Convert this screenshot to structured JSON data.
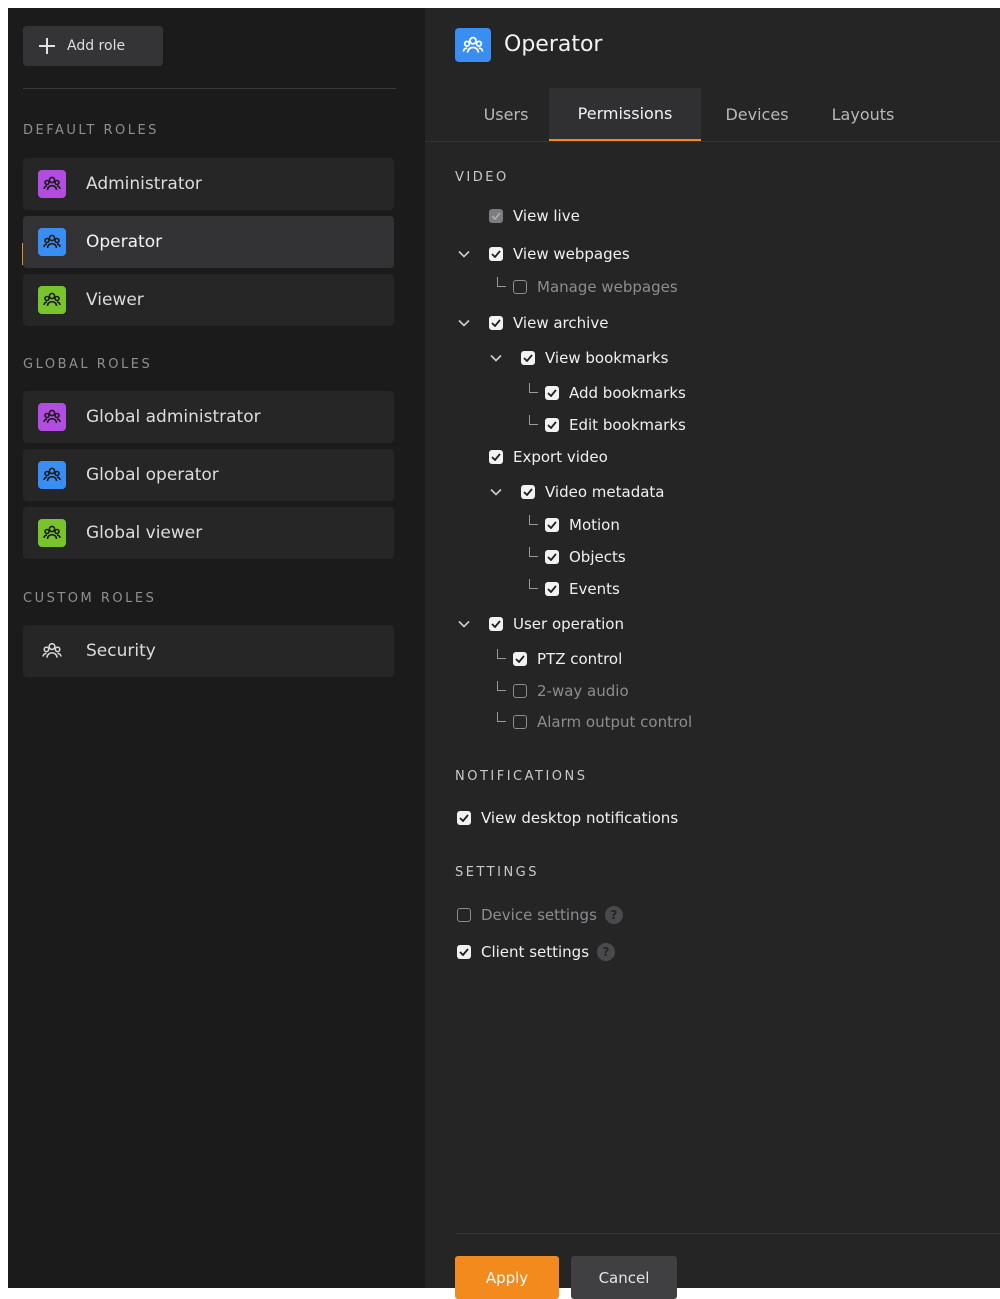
{
  "sidebar": {
    "add_role_label": "Add role",
    "sections": [
      {
        "title": "DEFAULT ROLES",
        "items": [
          {
            "label": "Administrator",
            "color": "#b34ce0"
          },
          {
            "label": "Operator",
            "color": "#3a8ef2",
            "selected": true
          },
          {
            "label": "Viewer",
            "color": "#78c42a"
          }
        ]
      },
      {
        "title": "GLOBAL ROLES",
        "items": [
          {
            "label": "Global administrator",
            "color": "#b34ce0"
          },
          {
            "label": "Global operator",
            "color": "#3a8ef2"
          },
          {
            "label": "Global viewer",
            "color": "#78c42a"
          }
        ]
      },
      {
        "title": "CUSTOM ROLES",
        "items": [
          {
            "label": "Security",
            "color": null
          }
        ]
      }
    ]
  },
  "header": {
    "title": "Operator",
    "icon": "users-group-icon",
    "icon_color": "#3a8ef2"
  },
  "tabs": [
    {
      "label": "Users",
      "active": false
    },
    {
      "label": "Permissions",
      "active": true
    },
    {
      "label": "Devices",
      "active": false
    },
    {
      "label": "Layouts",
      "active": false
    }
  ],
  "permissions": {
    "video": {
      "title": "VIDEO",
      "items": [
        {
          "label": "View live",
          "state": "disabled-checked"
        },
        {
          "label": "View webpages",
          "state": "checked",
          "expanded": true
        },
        {
          "label": "Manage webpages",
          "state": "unchecked"
        },
        {
          "label": "View archive",
          "state": "checked",
          "expanded": true
        },
        {
          "label": "View bookmarks",
          "state": "checked",
          "expanded": true
        },
        {
          "label": "Add bookmarks",
          "state": "checked"
        },
        {
          "label": "Edit bookmarks",
          "state": "checked"
        },
        {
          "label": "Export video",
          "state": "checked"
        },
        {
          "label": "Video metadata",
          "state": "checked",
          "expanded": true
        },
        {
          "label": "Motion",
          "state": "checked"
        },
        {
          "label": "Objects",
          "state": "checked"
        },
        {
          "label": "Events",
          "state": "checked"
        },
        {
          "label": "User operation",
          "state": "checked",
          "expanded": true
        },
        {
          "label": "PTZ control",
          "state": "checked"
        },
        {
          "label": "2-way audio",
          "state": "unchecked"
        },
        {
          "label": "Alarm output control",
          "state": "unchecked"
        }
      ]
    },
    "notifications": {
      "title": "NOTIFICATIONS",
      "items": [
        {
          "label": "View desktop notifications",
          "state": "checked"
        }
      ]
    },
    "settings": {
      "title": "SETTINGS",
      "items": [
        {
          "label": "Device settings",
          "state": "unchecked",
          "help": "?"
        },
        {
          "label": "Client settings",
          "state": "checked",
          "help": "?"
        }
      ]
    }
  },
  "footer": {
    "apply_label": "Apply",
    "cancel_label": "Cancel"
  },
  "colors": {
    "accent": "#f28a1e",
    "sidebar_bg": "#1b1b1c",
    "main_bg": "#252526"
  }
}
